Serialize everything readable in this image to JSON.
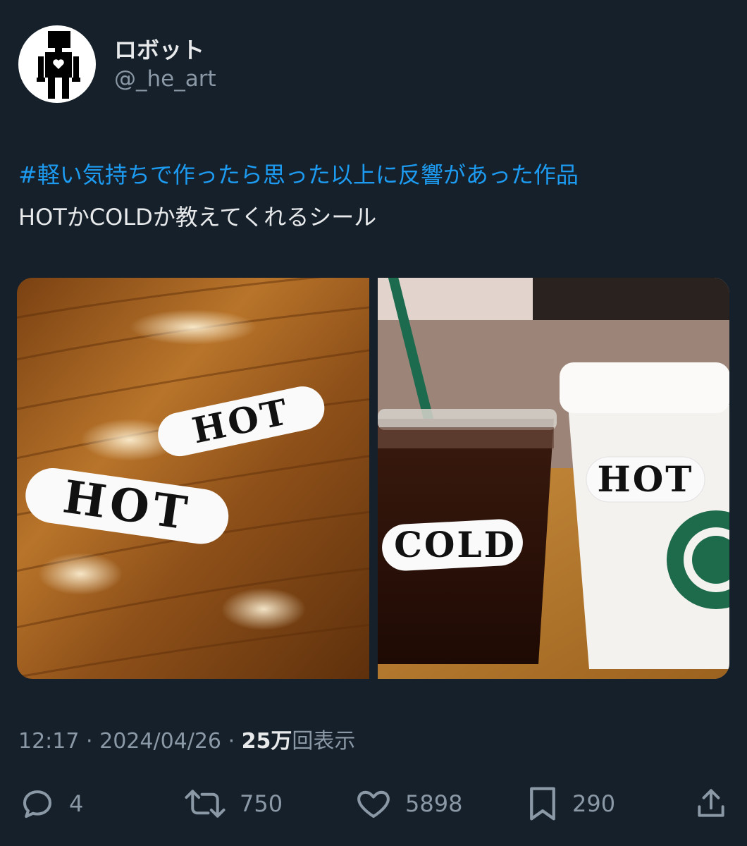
{
  "user": {
    "display_name": "ロボット",
    "handle": "@_he_art",
    "avatar_icon": "robot-heart-icon"
  },
  "tweet": {
    "hashtag": "#軽い気持ちで作ったら思った以上に反響があった作品",
    "text": "HOTかCOLDか教えてくれるシール",
    "media": [
      {
        "alt": "two HOT stickers on a wooden table",
        "sticker_labels": [
          "HOT",
          "HOT"
        ]
      },
      {
        "alt": "iced coffee with COLD sticker and hot cup with HOT sticker",
        "sticker_labels": [
          "COLD",
          "HOT"
        ]
      }
    ]
  },
  "meta": {
    "time": "12:17",
    "separator": "·",
    "date": "2024/04/26",
    "views_count": "25万",
    "views_label": "回表示"
  },
  "actions": {
    "replies": "4",
    "retweets": "750",
    "likes": "5898",
    "bookmarks": "290"
  },
  "colors": {
    "background": "#15202b",
    "link": "#1d9bf0",
    "secondary_text": "#8b98a5",
    "primary_text": "#e7e9ea"
  }
}
